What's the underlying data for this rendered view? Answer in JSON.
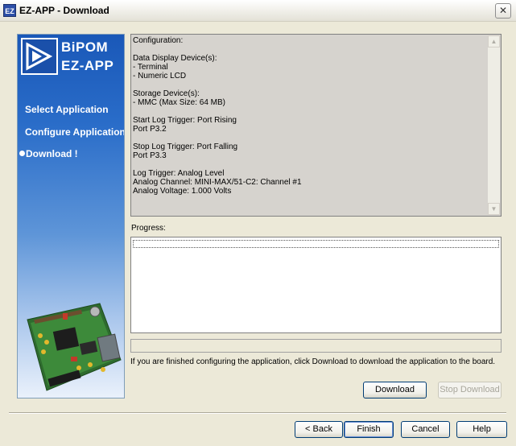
{
  "window": {
    "title": "EZ-APP - Download",
    "icon_text": "EZ",
    "close_glyph": "✕"
  },
  "sidebar": {
    "brand_line1": "BiPOM",
    "brand_line2": "EZ-APP",
    "steps": [
      {
        "label": "Select Application",
        "active": false
      },
      {
        "label": "Configure Application",
        "active": false
      },
      {
        "label": "Download !",
        "active": true
      }
    ]
  },
  "config": {
    "lines": [
      "Configuration:",
      "",
      "Data Display Device(s):",
      "- Terminal",
      "- Numeric LCD",
      "",
      "Storage Device(s):",
      "- MMC (Max Size: 64 MB)",
      "",
      "Start Log Trigger: Port Rising",
      "Port P3.2",
      "",
      "Stop Log Trigger: Port Falling",
      "Port P3.3",
      "",
      "Log Trigger: Analog Level",
      "Analog Channel: MINI-MAX/51-C2: Channel #1",
      "Analog Voltage: 1.000 Volts"
    ]
  },
  "progress": {
    "label": "Progress:",
    "status_text": ""
  },
  "instructions": "If you are finished configuring the application, click Download to download the application to the board.",
  "buttons": {
    "download": "Download",
    "stop_download": "Stop Download",
    "back": "< Back",
    "finish": "Finish",
    "cancel": "Cancel",
    "help": "Help"
  },
  "icons": {
    "scroll_up": "▲",
    "scroll_down": "▼"
  }
}
